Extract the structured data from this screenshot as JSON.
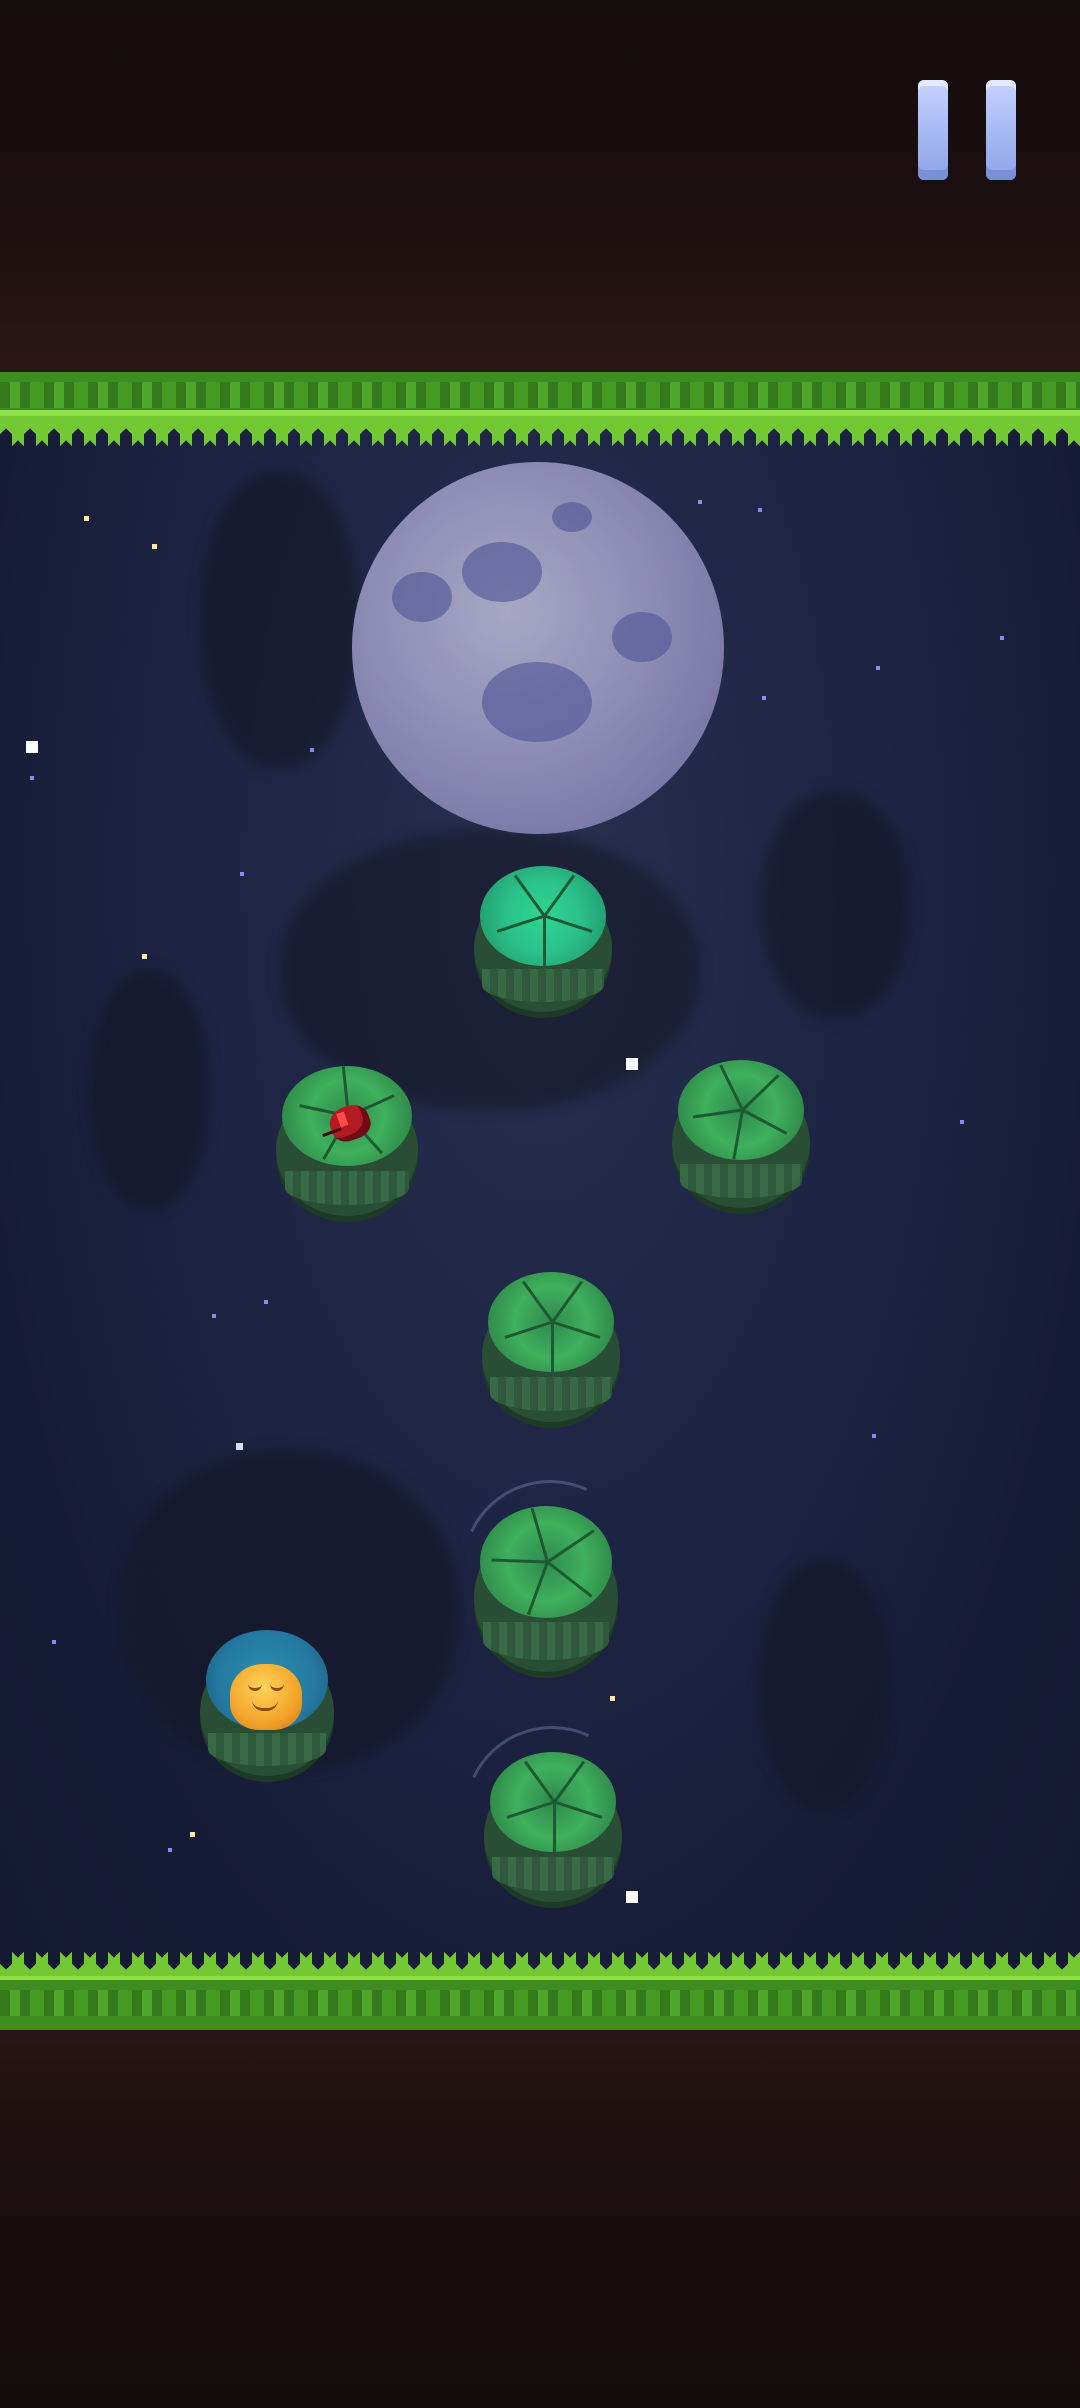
{
  "game": {
    "scene": "night pond",
    "controls": {
      "pause_icon": "pause-icon"
    },
    "player": {
      "sprite": "frog",
      "color": "#f4a52a"
    },
    "enemy": {
      "sprite": "red-bug",
      "color": "#b31a22"
    },
    "lily_pads": [
      {
        "id": "pad-top",
        "style": "bright"
      },
      {
        "id": "pad-left-bug",
        "style": "normal"
      },
      {
        "id": "pad-right",
        "style": "normal"
      },
      {
        "id": "pad-middle",
        "style": "normal"
      },
      {
        "id": "pad-wobbling-upper",
        "style": "normal",
        "moving": true
      },
      {
        "id": "pad-frog",
        "style": "bright"
      },
      {
        "id": "pad-wobbling-lower",
        "style": "normal",
        "moving": true
      }
    ],
    "colors": {
      "grass": "#3d8d21",
      "water": "#1e2544",
      "soil": "#1b0f10",
      "moon": "#a9a5d0",
      "pause": "#a4b8f2"
    }
  }
}
